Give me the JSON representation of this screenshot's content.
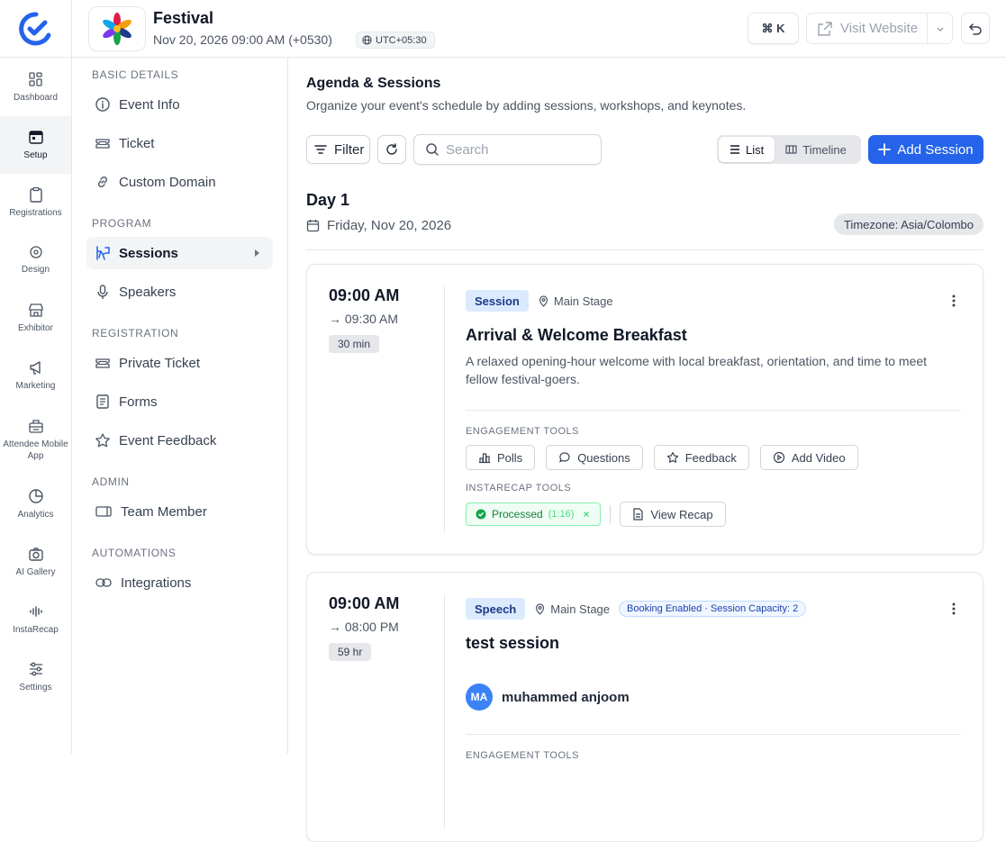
{
  "header": {
    "event_name": "Festival",
    "event_date": "Nov 20, 2026 09:00 AM (+0530)",
    "timezone": "UTC+05:30",
    "shortcut": "⌘ K",
    "visit_website": "Visit Website"
  },
  "rail": [
    {
      "label": "Dashboard",
      "icon": "dashboard-icon"
    },
    {
      "label": "Setup",
      "icon": "calendar-icon"
    },
    {
      "label": "Registrations",
      "icon": "clipboard-icon"
    },
    {
      "label": "Design",
      "icon": "design-icon"
    },
    {
      "label": "Exhibitor",
      "icon": "store-icon"
    },
    {
      "label": "Marketing",
      "icon": "megaphone-icon"
    },
    {
      "label": "Attendee Mobile App",
      "icon": "mobile-app-icon"
    },
    {
      "label": "Analytics",
      "icon": "pie-chart-icon"
    },
    {
      "label": "AI Gallery",
      "icon": "camera-icon"
    },
    {
      "label": "InstaRecap",
      "icon": "waveform-icon"
    },
    {
      "label": "Settings",
      "icon": "sliders-icon"
    }
  ],
  "sidebar": {
    "basic_title": "BASIC DETAILS",
    "basic": [
      {
        "label": "Event Info",
        "icon": "info-icon"
      },
      {
        "label": "Ticket",
        "icon": "ticket-icon"
      },
      {
        "label": "Custom Domain",
        "icon": "link-icon"
      }
    ],
    "program_title": "PROGRAM",
    "program": [
      {
        "label": "Sessions",
        "icon": "sessions-icon"
      },
      {
        "label": "Speakers",
        "icon": "mic-icon"
      }
    ],
    "registration_title": "REGISTRATION",
    "registration": [
      {
        "label": "Private Ticket",
        "icon": "ticket-icon"
      },
      {
        "label": "Forms",
        "icon": "form-icon"
      },
      {
        "label": "Event Feedback",
        "icon": "star-icon"
      }
    ],
    "admin_title": "ADMIN",
    "admin": [
      {
        "label": "Team Member",
        "icon": "team-icon"
      }
    ],
    "automations_title": "AUTOMATIONS",
    "automations": [
      {
        "label": "Integrations",
        "icon": "integrations-icon"
      }
    ]
  },
  "main": {
    "title": "Agenda & Sessions",
    "subtitle": "Organize your event's schedule by adding sessions, workshops, and keynotes.",
    "filter": "Filter",
    "search_placeholder": "Search",
    "view_list": "List",
    "view_timeline": "Timeline",
    "add_session": "Add Session",
    "day_title": "Day 1",
    "day_date": "Friday, Nov 20, 2026",
    "day_timezone": "Timezone: Asia/Colombo"
  },
  "sessions": [
    {
      "start": "09:00 AM",
      "end": "→ 09:30 AM",
      "duration": "30 min",
      "type": "Session",
      "location": "Main Stage",
      "title": "Arrival & Welcome Breakfast",
      "description": "A relaxed opening-hour welcome with local breakfast, orientation, and time to meet fellow festival-goers.",
      "engagement_label": "ENGAGEMENT TOOLS",
      "tools": [
        "Polls",
        "Questions",
        "Feedback",
        "Add Video"
      ],
      "instarecap_label": "INSTARECAP TOOLS",
      "processed": "Processed",
      "processed_duration": "(1:16)",
      "view_recap": "View Recap"
    },
    {
      "start": "09:00 AM",
      "end": "→ 08:00 PM",
      "duration": "59 hr",
      "type": "Speech",
      "location": "Main Stage",
      "booking": "Booking Enabled · Session Capacity: 2",
      "title": "test session",
      "speaker_initials": "MA",
      "speaker_name": "muhammed anjoom",
      "engagement_label": "ENGAGEMENT TOOLS"
    }
  ],
  "colors": {
    "accent": "#2563eb",
    "badge_bg": "#dbeafe",
    "success": "#15803d"
  }
}
